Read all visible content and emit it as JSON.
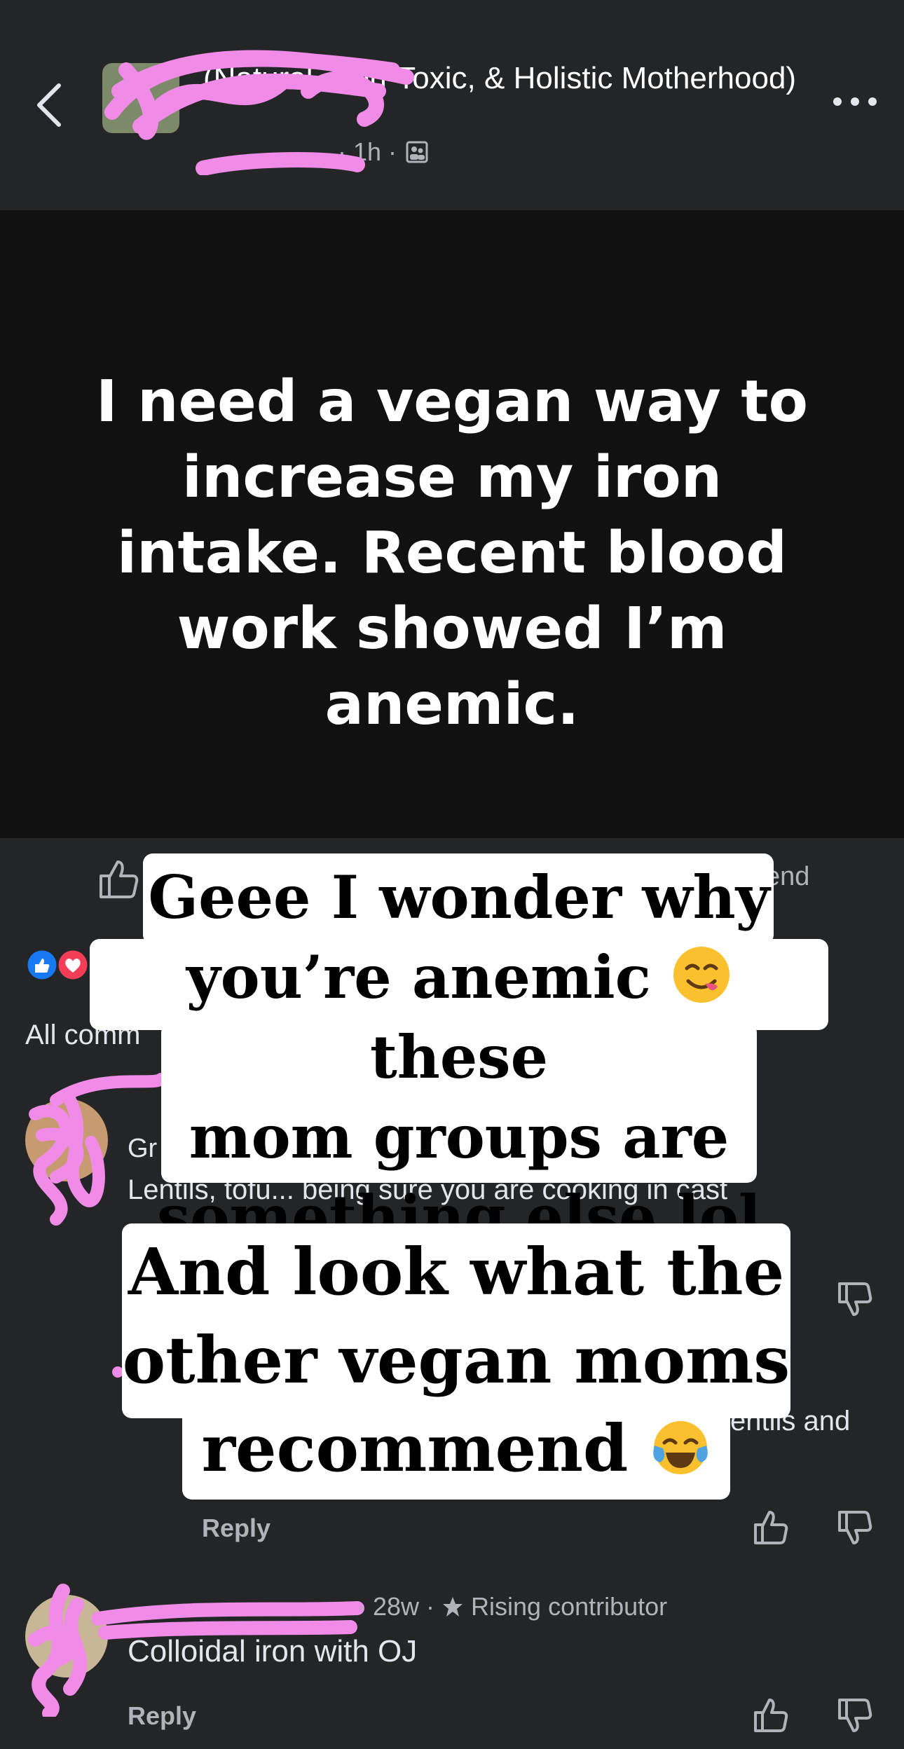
{
  "header": {
    "group_name": "(Natural, Non-Toxic, & Holistic Motherhood)",
    "meta_time": "· 1h ·"
  },
  "post": {
    "text": "I need a vegan way to increase my iron intake. Recent blood work showed I’m anemic."
  },
  "actions": {
    "send_fragment": "end"
  },
  "comments_header": "All comm",
  "comments": [
    {
      "name_fragment": "Gr",
      "text": "Lentils, tofu... being sure you are cooking in cast"
    },
    {
      "text_fragment": "entils and",
      "reply_label": "Reply"
    },
    {
      "meta_time": "· 28w ·",
      "badge": "Rising contributor",
      "text": "Colloidal iron with OJ",
      "reply_label": "Reply"
    }
  ],
  "overlay_captions": {
    "caption1_line1": "Geee I wonder why",
    "caption1_line2a": "you’re anemic",
    "caption1_line2b": "these",
    "caption1_line3": "mom groups are",
    "caption1_line4": "something else lol",
    "caption2_line1": "And look what the",
    "caption2_line2": "other vegan moms",
    "caption2_line3": "recommend"
  },
  "icons": {
    "back": "chevron-left-icon",
    "more": "more-icon",
    "group_privacy": "group-members-icon",
    "like": "thumbs-up-icon",
    "dislike": "thumbs-down-icon",
    "star": "star-icon",
    "emoji1": "yum-face-emoji",
    "emoji2": "tears-of-joy-emoji"
  },
  "colors": {
    "background": "#242526",
    "post_bg": "#111111",
    "scribble": "#f08ce8",
    "like_blue": "#1877f2",
    "love_red": "#f33e58"
  }
}
